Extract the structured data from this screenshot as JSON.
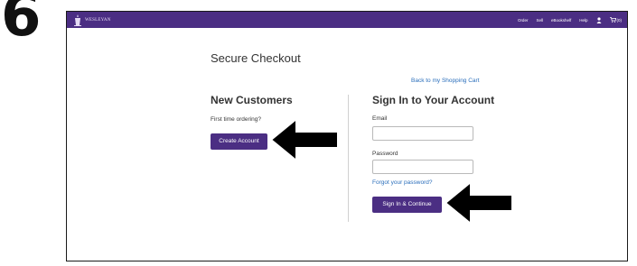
{
  "step": {
    "number": "6"
  },
  "header": {
    "logo_text": "WESLEYAN",
    "nav": [
      {
        "label": "Order"
      },
      {
        "label": "Sell"
      },
      {
        "label": "eBookshelf"
      },
      {
        "label": "Help"
      }
    ],
    "cart_count": "(0)"
  },
  "page": {
    "title": "Secure Checkout",
    "back_link": "Back to my Shopping Cart"
  },
  "new_customers": {
    "heading": "New Customers",
    "prompt": "First time ordering?",
    "button": "Create Account"
  },
  "sign_in": {
    "heading": "Sign In to Your Account",
    "email_label": "Email",
    "email_value": "",
    "password_label": "Password",
    "password_value": "",
    "forgot_link": "Forgot your password?",
    "button": "Sign In & Continue"
  },
  "colors": {
    "brand_purple": "#4b2e83",
    "link_blue": "#2a6ebb"
  }
}
